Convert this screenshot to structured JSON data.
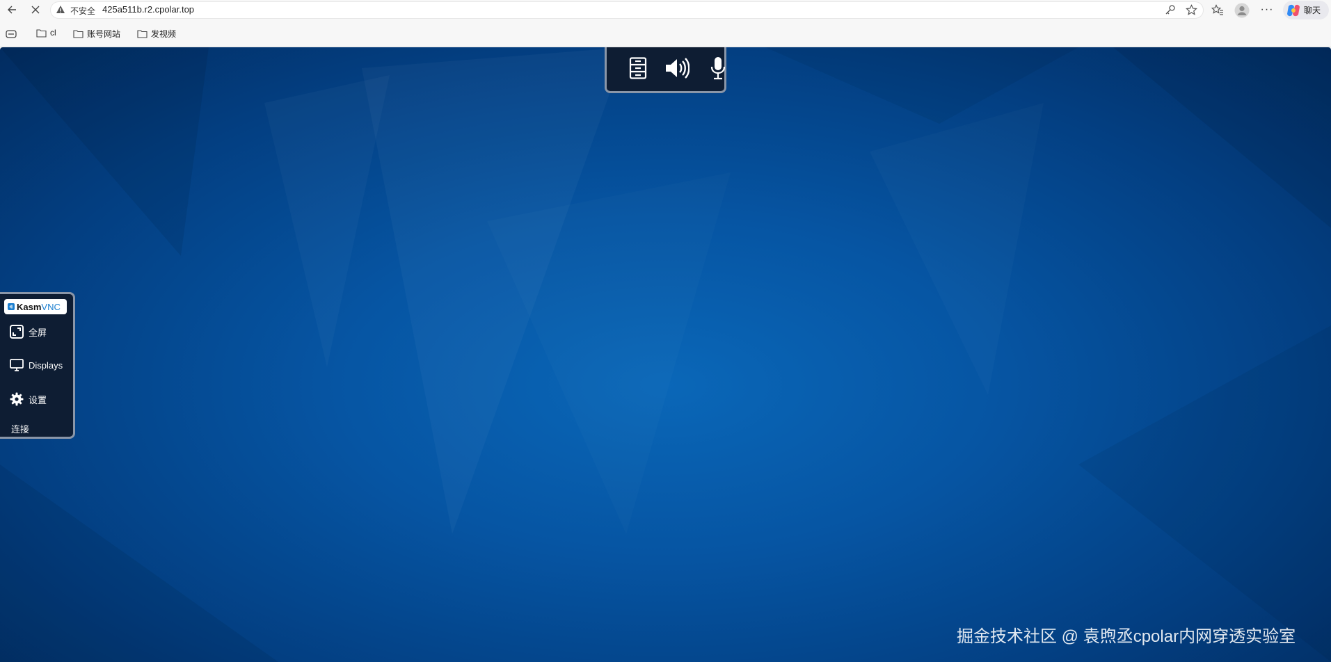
{
  "browser": {
    "security_label": "不安全",
    "url": "425a511b.r2.cpolar.top",
    "chat_label": "聊天",
    "more_label": "···"
  },
  "bookmarks": [
    {
      "label": "cl"
    },
    {
      "label": "账号网站"
    },
    {
      "label": "发视频"
    }
  ],
  "kasm": {
    "logo_kasm": "Kasm",
    "logo_vnc": "VNC",
    "menu": {
      "fullscreen": "全屏",
      "displays": "Displays",
      "settings": "设置",
      "connect": "连接"
    }
  },
  "watermark": "掘金技术社区 @ 袁煦丞cpolar内网穿透实验室",
  "colors": {
    "desktop_blue": "#0655a3",
    "panel_bg": "#0e1d33",
    "panel_border": "#8a96a8"
  }
}
